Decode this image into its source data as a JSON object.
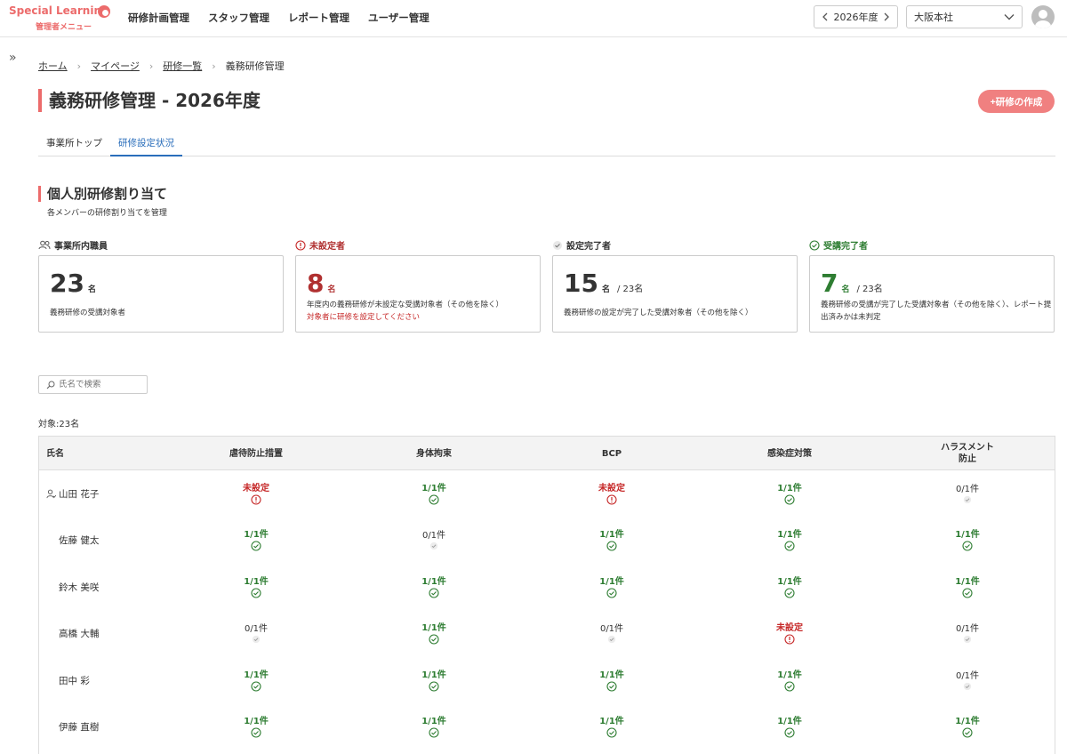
{
  "brand": {
    "name": "Special Learning",
    "sub": "管理者メニュー",
    "color": "#ec6b6b"
  },
  "nav": [
    "研修計画管理",
    "スタッフ管理",
    "レポート管理",
    "ユーザー管理"
  ],
  "year_selector": {
    "value": "2026年度"
  },
  "org_selector": {
    "value": "大阪本社"
  },
  "breadcrumb": [
    "ホーム",
    "マイページ",
    "研修一覧",
    "義務研修管理"
  ],
  "page_title": "義務研修管理 - 2026年度",
  "create_button": "+研修の作成",
  "tabs": [
    {
      "label": "事業所トップ",
      "active": false
    },
    {
      "label": "研修設定状況",
      "active": true
    }
  ],
  "section": {
    "title": "個人別研修割り当て",
    "subtitle": "各メンバーの研修割り当てを管理"
  },
  "stats": [
    {
      "label": "事業所内職員",
      "icon": "people-icon",
      "value": "23",
      "unit": "名",
      "total": "",
      "desc": "義務研修の受講対象者",
      "warn": "",
      "color": "#333333"
    },
    {
      "label": "未設定者",
      "icon": "alert-circle-icon",
      "value": "8",
      "unit": "名",
      "total": "",
      "desc": "年度内の義務研修が未設定な受講対象者（その他を除く）",
      "warn": "対象者に研修を設定してください",
      "color": "#b03030"
    },
    {
      "label": "設定完了者",
      "icon": "check-icon",
      "value": "15",
      "unit": "名",
      "total": "/ 23名",
      "desc": "義務研修の設定が完了した受講対象者（その他を除く）",
      "warn": "",
      "color": "#333333"
    },
    {
      "label": "受講完了者",
      "icon": "check-circle-icon",
      "value": "7",
      "unit": "名",
      "total": "/ 23名",
      "desc": "義務研修の受講が完了した受講対象者（その他を除く）、レポート提出済みかは未判定",
      "warn": "",
      "color": "#2e7d32"
    }
  ],
  "search": {
    "placeholder": "氏名で検索"
  },
  "count_label": "対象:23名",
  "table": {
    "name_header": "氏名",
    "columns": [
      "虐待防止措置",
      "身体拘束",
      "BCP",
      "感染症対策",
      "ハラスメント\n防止"
    ],
    "rows": [
      {
        "name": "山田 花子",
        "self": true,
        "cells": [
          {
            "text": "未設定",
            "status": "unset"
          },
          {
            "text": "1/1件",
            "status": "done"
          },
          {
            "text": "未設定",
            "status": "unset"
          },
          {
            "text": "1/1件",
            "status": "done"
          },
          {
            "text": "0/1件",
            "status": "pending"
          }
        ]
      },
      {
        "name": "佐藤 健太",
        "self": false,
        "cells": [
          {
            "text": "1/1件",
            "status": "done"
          },
          {
            "text": "0/1件",
            "status": "pending"
          },
          {
            "text": "1/1件",
            "status": "done"
          },
          {
            "text": "1/1件",
            "status": "done"
          },
          {
            "text": "1/1件",
            "status": "done"
          }
        ]
      },
      {
        "name": "鈴木 美咲",
        "self": false,
        "cells": [
          {
            "text": "1/1件",
            "status": "done"
          },
          {
            "text": "1/1件",
            "status": "done"
          },
          {
            "text": "1/1件",
            "status": "done"
          },
          {
            "text": "1/1件",
            "status": "done"
          },
          {
            "text": "1/1件",
            "status": "done"
          }
        ]
      },
      {
        "name": "高橋 大輔",
        "self": false,
        "cells": [
          {
            "text": "0/1件",
            "status": "pending"
          },
          {
            "text": "1/1件",
            "status": "done"
          },
          {
            "text": "0/1件",
            "status": "pending"
          },
          {
            "text": "未設定",
            "status": "unset"
          },
          {
            "text": "0/1件",
            "status": "pending"
          }
        ]
      },
      {
        "name": "田中 彩",
        "self": false,
        "cells": [
          {
            "text": "1/1件",
            "status": "done"
          },
          {
            "text": "1/1件",
            "status": "done"
          },
          {
            "text": "1/1件",
            "status": "done"
          },
          {
            "text": "1/1件",
            "status": "done"
          },
          {
            "text": "0/1件",
            "status": "pending"
          }
        ]
      },
      {
        "name": "伊藤 直樹",
        "self": false,
        "cells": [
          {
            "text": "1/1件",
            "status": "done"
          },
          {
            "text": "1/1件",
            "status": "done"
          },
          {
            "text": "1/1件",
            "status": "done"
          },
          {
            "text": "1/1件",
            "status": "done"
          },
          {
            "text": "1/1件",
            "status": "done"
          }
        ]
      }
    ]
  },
  "status_colors": {
    "done": "#2e7d32",
    "unset": "#c62828",
    "pending": "#9e9e9e"
  }
}
